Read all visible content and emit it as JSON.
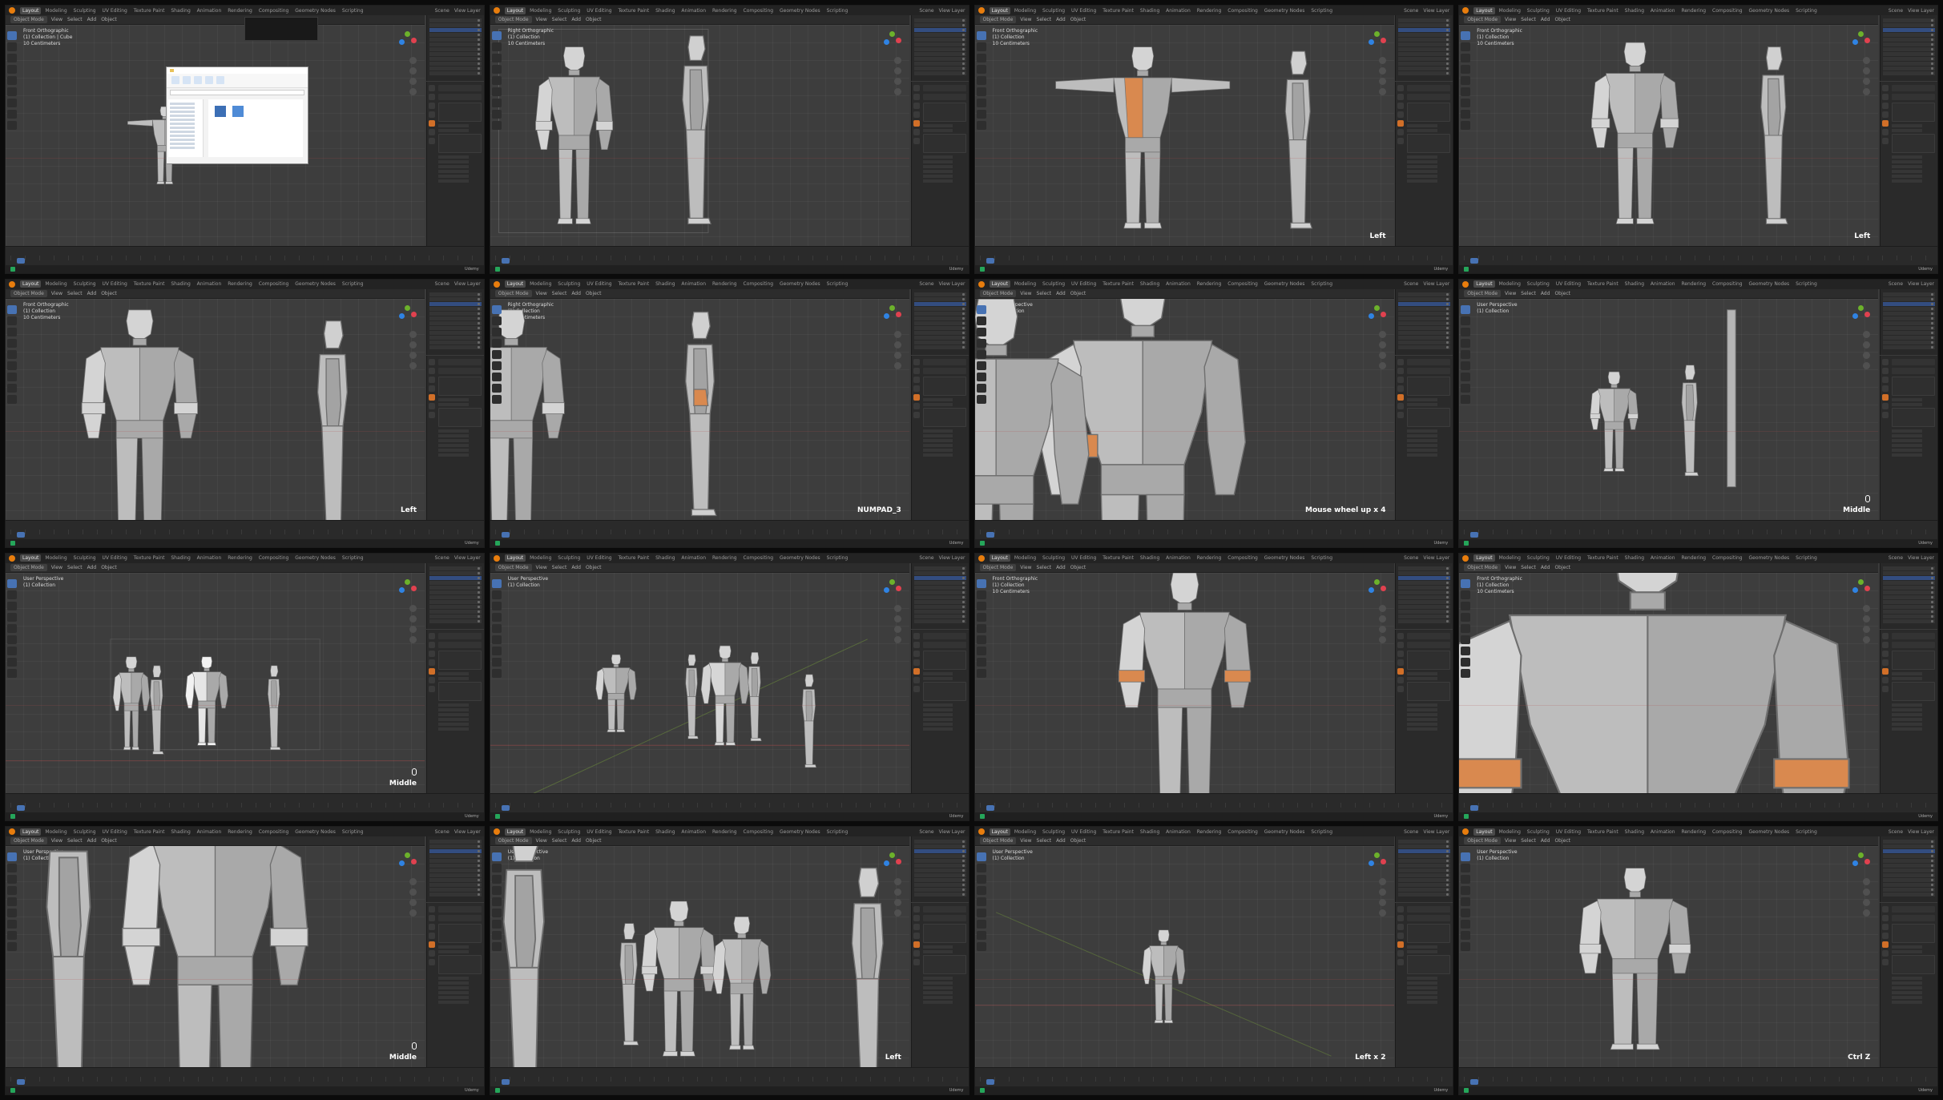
{
  "app": {
    "workspaces": [
      "Layout",
      "Modeling",
      "Sculpting",
      "UV Editing",
      "Texture Paint",
      "Shading",
      "Animation",
      "Rendering",
      "Compositing",
      "Geometry Nodes",
      "Scripting"
    ],
    "active_workspace": "Layout",
    "scene_label": "Scene",
    "view_layer_label": "View Layer",
    "mode_label": "Object Mode",
    "menus": [
      "View",
      "Select",
      "Add",
      "Object"
    ],
    "status_brand": "Udemy",
    "colors": {
      "accent_orange": "#e87d0d",
      "selection_blue": "#4772b3",
      "axis_x": "#e0414f",
      "axis_y": "#6cb12b",
      "axis_z": "#2f83e3",
      "highlight_face": "#d9894f"
    }
  },
  "panels": [
    {
      "view": "Front Orthographic",
      "collection": "(1) Collection | Cube",
      "sub": "10 Centimeters",
      "keycast": "",
      "variant": "dialog"
    },
    {
      "view": "Right Orthographic",
      "collection": "(1) Collection",
      "sub": "10 Centimeters",
      "keycast": "",
      "variant": "side-ref"
    },
    {
      "view": "Front Orthographic",
      "collection": "(1) Collection",
      "sub": "10 Centimeters",
      "keycast": "Left",
      "variant": "tpose"
    },
    {
      "view": "Front Orthographic",
      "collection": "(1) Collection",
      "sub": "10 Centimeters",
      "keycast": "Left",
      "variant": "front-side"
    },
    {
      "view": "Front Orthographic",
      "collection": "(1) Collection",
      "sub": "10 Centimeters",
      "keycast": "Left",
      "variant": "front-side-zoom"
    },
    {
      "view": "Right Orthographic",
      "collection": "(1) Collection",
      "sub": "10 Centimeters",
      "keycast": "NUMPAD_3",
      "variant": "side-zoom"
    },
    {
      "view": "User Perspective",
      "collection": "(1) Collection",
      "sub": "",
      "keycast": "Mouse wheel up x 4",
      "variant": "closeup"
    },
    {
      "view": "User Perspective",
      "collection": "(1) Collection",
      "sub": "",
      "keycast": "Middle",
      "variant": "three"
    },
    {
      "view": "User Perspective",
      "collection": "(1) Collection",
      "sub": "",
      "keycast": "Middle",
      "variant": "room"
    },
    {
      "view": "User Perspective",
      "collection": "(1) Collection",
      "sub": "",
      "keycast": "",
      "variant": "crowd"
    },
    {
      "view": "Front Orthographic",
      "collection": "(1) Collection",
      "sub": "10 Centimeters",
      "keycast": "",
      "variant": "front-big"
    },
    {
      "view": "Front Orthographic",
      "collection": "(1) Collection",
      "sub": "10 Centimeters",
      "keycast": "",
      "variant": "torso"
    },
    {
      "view": "User Perspective",
      "collection": "(1) Collection",
      "sub": "",
      "keycast": "Middle",
      "variant": "legs"
    },
    {
      "view": "User Perspective",
      "collection": "(1) Collection",
      "sub": "",
      "keycast": "Left",
      "variant": "group"
    },
    {
      "view": "User Perspective",
      "collection": "(1) Collection",
      "sub": "",
      "keycast": "Left x 2",
      "variant": "small"
    },
    {
      "view": "User Perspective",
      "collection": "(1) Collection",
      "sub": "",
      "keycast": "Ctrl Z",
      "variant": "low"
    }
  ]
}
